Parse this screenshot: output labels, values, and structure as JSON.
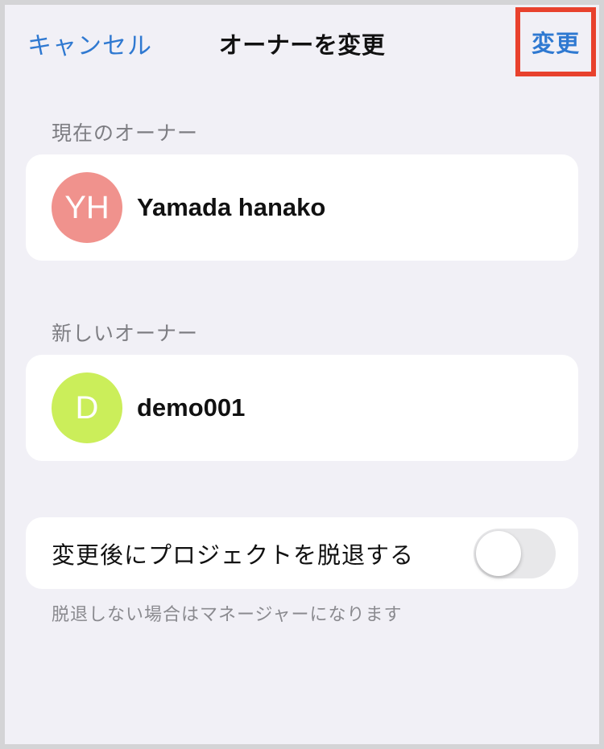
{
  "nav": {
    "cancel_label": "キャンセル",
    "title": "オーナーを変更",
    "change_label": "変更"
  },
  "current_owner": {
    "header": "現在のオーナー",
    "initials": "YH",
    "name": "Yamada hanako",
    "avatar_color": "#f0928d"
  },
  "new_owner": {
    "header": "新しいオーナー",
    "initials": "D",
    "name": "demo001",
    "avatar_color": "#cbee5a"
  },
  "leave_option": {
    "label": "変更後にプロジェクトを脱退する",
    "enabled": false,
    "note": "脱退しない場合はマネージャーになります"
  },
  "colors": {
    "accent": "#2f79d1",
    "highlight": "#e8412d",
    "background": "#f1f0f6"
  }
}
